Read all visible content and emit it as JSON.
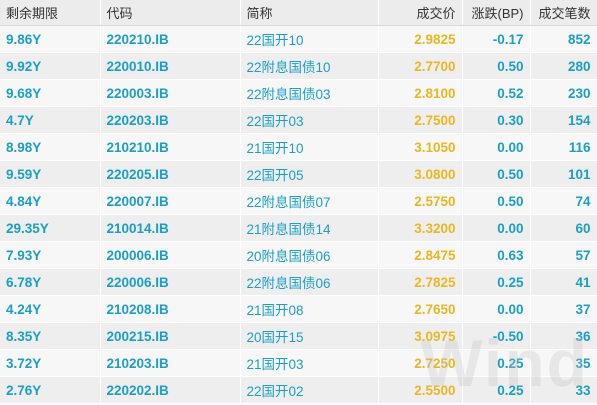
{
  "table": {
    "columns": [
      "剩余期限",
      "代码",
      "简称",
      "成交价",
      "涨跌(BP)",
      "成交笔数"
    ],
    "rows": [
      {
        "term": "9.86Y",
        "code": "220210.IB",
        "name": "22国开10",
        "price": "2.9825",
        "change": "-0.17",
        "count": "852"
      },
      {
        "term": "9.92Y",
        "code": "220010.IB",
        "name": "22附息国债10",
        "price": "2.7700",
        "change": "0.50",
        "count": "280"
      },
      {
        "term": "9.68Y",
        "code": "220003.IB",
        "name": "22附息国债03",
        "price": "2.8100",
        "change": "0.52",
        "count": "230"
      },
      {
        "term": "4.7Y",
        "code": "220203.IB",
        "name": "22国开03",
        "price": "2.7500",
        "change": "0.30",
        "count": "154"
      },
      {
        "term": "8.98Y",
        "code": "210210.IB",
        "name": "21国开10",
        "price": "3.1050",
        "change": "0.00",
        "count": "116"
      },
      {
        "term": "9.59Y",
        "code": "220205.IB",
        "name": "22国开05",
        "price": "3.0800",
        "change": "0.50",
        "count": "101"
      },
      {
        "term": "4.84Y",
        "code": "220007.IB",
        "name": "22附息国债07",
        "price": "2.5750",
        "change": "0.50",
        "count": "74"
      },
      {
        "term": "29.35Y",
        "code": "210014.IB",
        "name": "21附息国债14",
        "price": "3.3200",
        "change": "0.00",
        "count": "60"
      },
      {
        "term": "7.93Y",
        "code": "200006.IB",
        "name": "20附息国债06",
        "price": "2.8475",
        "change": "0.63",
        "count": "57"
      },
      {
        "term": "6.78Y",
        "code": "220006.IB",
        "name": "22附息国债06",
        "price": "2.7825",
        "change": "0.25",
        "count": "41"
      },
      {
        "term": "4.24Y",
        "code": "210208.IB",
        "name": "21国开08",
        "price": "2.7650",
        "change": "0.00",
        "count": "37"
      },
      {
        "term": "8.35Y",
        "code": "200215.IB",
        "name": "20国开15",
        "price": "3.0975",
        "change": "-0.50",
        "count": "36"
      },
      {
        "term": "3.72Y",
        "code": "210203.IB",
        "name": "21国开03",
        "price": "2.7250",
        "change": "0.25",
        "count": "35"
      },
      {
        "term": "2.76Y",
        "code": "220202.IB",
        "name": "22国开02",
        "price": "2.5500",
        "change": "0.25",
        "count": "33"
      }
    ]
  },
  "watermark": "Wind",
  "colors": {
    "header_bg": "#ececec",
    "row_odd": "#f7f7f7",
    "row_even": "#eeeeee",
    "text_blue": "#1a9fc6",
    "price_gold": "#e8b81f"
  }
}
